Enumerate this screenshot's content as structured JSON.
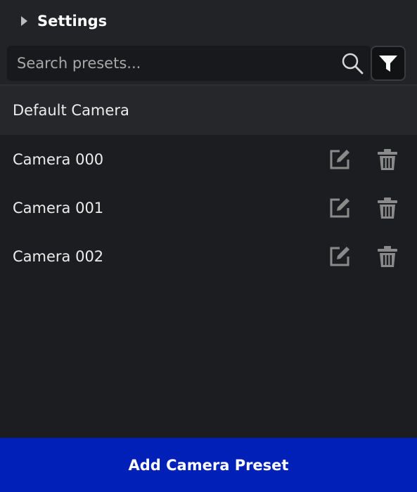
{
  "header": {
    "title": "Settings",
    "expand_icon": "chevron-right-icon"
  },
  "search": {
    "placeholder": "Search presets...",
    "value": "",
    "search_icon": "search-icon",
    "filter_icon": "filter-icon"
  },
  "presets": {
    "default_label": "Default Camera",
    "items": [
      {
        "label": "Camera 000",
        "edit_icon": "edit-icon",
        "delete_icon": "trash-icon"
      },
      {
        "label": "Camera 001",
        "edit_icon": "edit-icon",
        "delete_icon": "trash-icon"
      },
      {
        "label": "Camera 002",
        "edit_icon": "edit-icon",
        "delete_icon": "trash-icon"
      }
    ]
  },
  "footer": {
    "add_label": "Add Camera Preset"
  },
  "colors": {
    "background": "#1c1d21",
    "header_bg": "#222327",
    "selected_row": "#26272b",
    "accent": "#0020b8",
    "icon_gray": "#8a8a8a"
  }
}
